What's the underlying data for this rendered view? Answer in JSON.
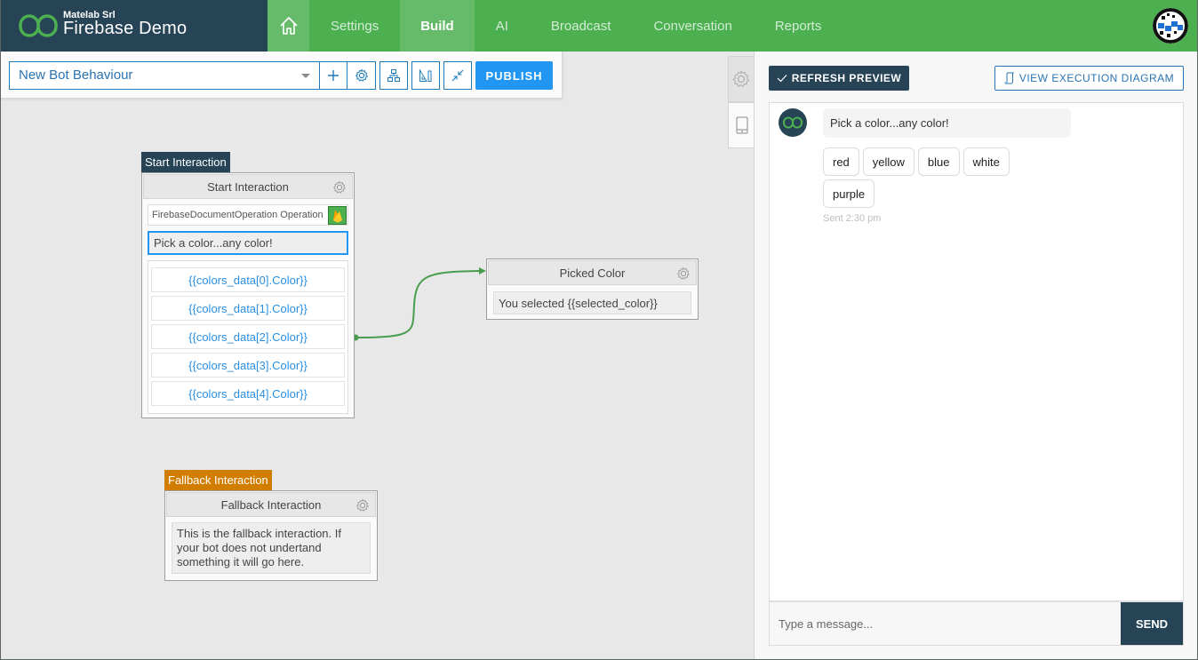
{
  "brand": {
    "company": "Matelab Srl",
    "title": "Firebase Demo",
    "logo_icon": "infinity-logo-icon"
  },
  "nav": {
    "home_icon": "home-icon",
    "items": [
      {
        "label": "Settings",
        "active": false
      },
      {
        "label": "Build",
        "active": true
      },
      {
        "label": "AI",
        "active": false
      },
      {
        "label": "Broadcast",
        "active": false
      },
      {
        "label": "Conversation",
        "active": false
      },
      {
        "label": "Reports",
        "active": false
      }
    ],
    "user_avatar": "user-avatar"
  },
  "toolbar": {
    "behaviour_select": "New Bot Behaviour",
    "buttons": [
      {
        "icon": "plus-icon",
        "title": "Add"
      },
      {
        "icon": "gear-icon",
        "title": "Settings"
      },
      {
        "icon": "hierarchy-icon",
        "title": "Arrange"
      },
      {
        "icon": "ruler-icon",
        "title": "Measure"
      },
      {
        "icon": "compress-icon",
        "title": "Compress"
      }
    ],
    "publish_label": "PUBLISH"
  },
  "canvas": {
    "start_node": {
      "tag": "Start Interaction",
      "title": "Start Interaction",
      "operation": "FirebaseDocumentOperation Operation",
      "message": "Pick a color...any color!",
      "buttons": [
        "{{colors_data[0].Color}}",
        "{{colors_data[1].Color}}",
        "{{colors_data[2].Color}}",
        "{{colors_data[3].Color}}",
        "{{colors_data[4].Color}}"
      ]
    },
    "picked_node": {
      "title": "Picked Color",
      "message": "You selected {{selected_color}}"
    },
    "fallback_node": {
      "tag": "Fallback Interaction",
      "title": "Fallback Interaction",
      "message": "This is the fallback interaction. If your bot does not undertand something it will go here."
    }
  },
  "colors": {
    "brand_dark": "#264456",
    "nav_green": "#4caf50",
    "nav_active": "#66bb6a",
    "accent_blue": "#2196f3",
    "fallback_orange": "#d07d00",
    "connector": "#4a9d4e"
  },
  "preview": {
    "refresh_label": "REFRESH PREVIEW",
    "exec_label": "VIEW EXECUTION DIAGRAM",
    "bot_message": "Pick a color...any color!",
    "quick_replies": [
      "red",
      "yellow",
      "blue",
      "white",
      "purple"
    ],
    "sent_time": "Sent 2:30 pm",
    "input_placeholder": "Type a message...",
    "send_label": "SEND"
  }
}
